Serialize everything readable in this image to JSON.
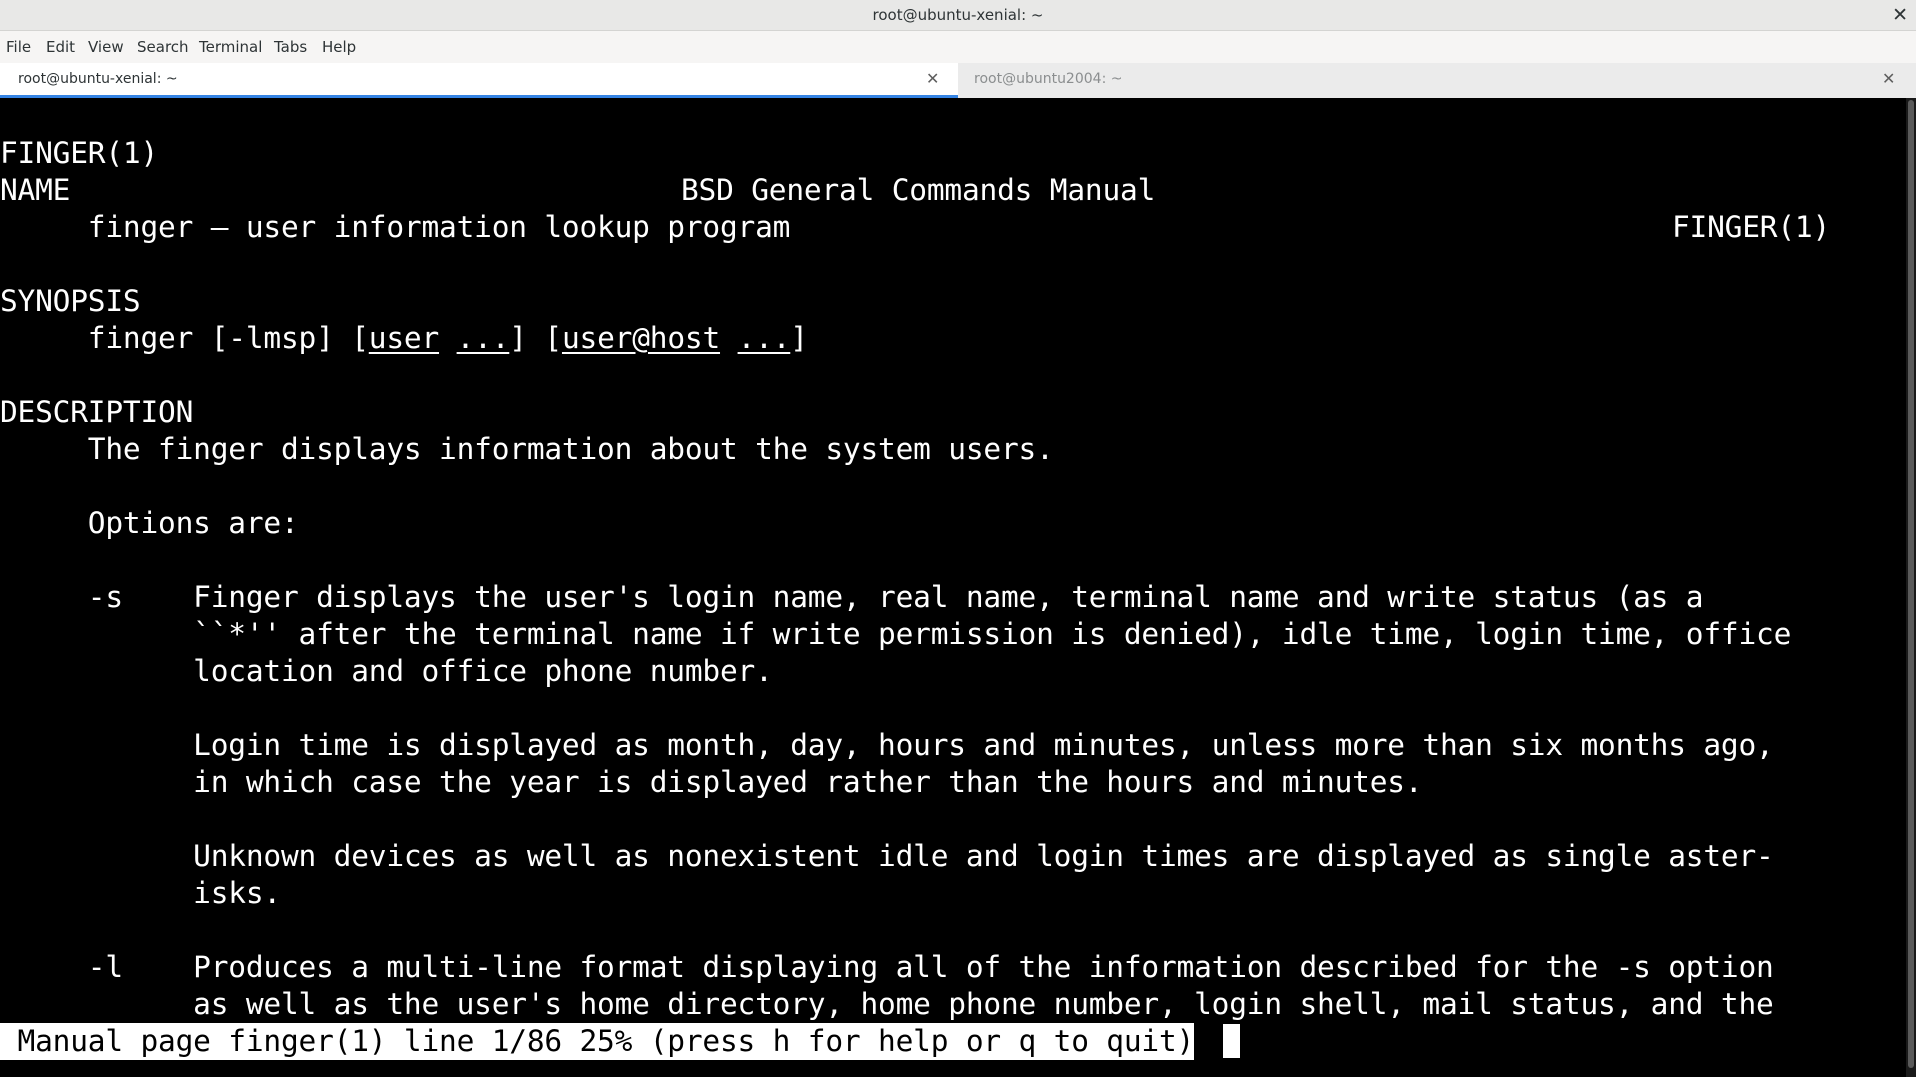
{
  "window": {
    "title": "root@ubuntu-xenial: ~",
    "close_glyph": "✕"
  },
  "menu": [
    "File",
    "Edit",
    "View",
    "Search",
    "Terminal",
    "Tabs",
    "Help"
  ],
  "tabs": [
    {
      "label": "root@ubuntu-xenial: ~",
      "active": true
    },
    {
      "label": "root@ubuntu2004: ~",
      "active": false
    }
  ],
  "tab_close_glyph": "✕",
  "colors": {
    "accent": "#3584e4",
    "terminal_bg": "#000000",
    "terminal_fg": "#ffffff"
  },
  "man": {
    "header_left": "FINGER(1)",
    "header_center": "BSD General Commands Manual",
    "header_right": "FINGER(1)",
    "name_heading": "NAME",
    "name_line": "     finger – user information lookup program",
    "synopsis_heading": "SYNOPSIS",
    "syn_prefix": "     finger [-lmsp] [",
    "syn_user": "user",
    "syn_sp1": " ",
    "syn_dots1": "...",
    "syn_mid": "] [",
    "syn_userhost": "user@host",
    "syn_sp2": " ",
    "syn_dots2": "...",
    "syn_end": "]",
    "description_heading": "DESCRIPTION",
    "desc_line": "     The finger displays information about the system users.",
    "options_line": "     Options are:",
    "opt_s_1": "     -s    Finger displays the user's login name, real name, terminal name and write status (as a",
    "opt_s_2": "           ``*'' after the terminal name if write permission is denied), idle time, login time, office",
    "opt_s_3": "           location and office phone number.",
    "login_1": "           Login time is displayed as month, day, hours and minutes, unless more than six months ago,",
    "login_2": "           in which case the year is displayed rather than the hours and minutes.",
    "unknown_1": "           Unknown devices as well as nonexistent idle and login times are displayed as single aster-",
    "unknown_2": "           isks.",
    "opt_l_1": "     -l    Produces a multi-line format displaying all of the information described for the -s option",
    "opt_l_2": "           as well as the user's home directory, home phone number, login shell, mail status, and the"
  },
  "status_line": " Manual page finger(1) line 1/86 25% (press h for help or q to quit)"
}
